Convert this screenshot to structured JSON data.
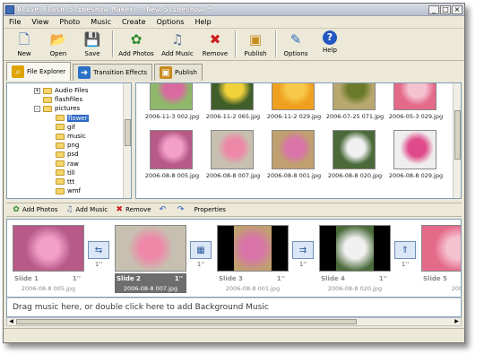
{
  "window": {
    "title": "Alive Flash Slideshow Maker - New Slideshow *",
    "controls": [
      "_",
      "□",
      "×"
    ]
  },
  "menu": [
    "File",
    "View",
    "Photo",
    "Music",
    "Create",
    "Options",
    "Help"
  ],
  "toolbar": [
    {
      "label": "New",
      "icon": "new-file-icon",
      "glyph": "🗋",
      "color": "#2e5fb0"
    },
    {
      "label": "Open",
      "icon": "folder-open-icon",
      "glyph": "📂",
      "color": "#d9a521"
    },
    {
      "label": "Save",
      "icon": "floppy-save-icon",
      "glyph": "💾",
      "color": "#3d55b8"
    },
    {
      "label": "Add Photos",
      "icon": "add-photos-icon",
      "glyph": "✿",
      "color": "#2d8a2d"
    },
    {
      "label": "Add Music",
      "icon": "add-music-icon",
      "glyph": "♫",
      "color": "#5c6f9c"
    },
    {
      "label": "Remove",
      "icon": "remove-x-icon",
      "glyph": "✖",
      "color": "#cc1f1f"
    },
    {
      "label": "Publish",
      "icon": "publish-icon",
      "glyph": "▣",
      "color": "#c88a1c"
    },
    {
      "label": "Options",
      "icon": "options-icon",
      "glyph": "✎",
      "color": "#2c6cc0"
    },
    {
      "label": "Help",
      "icon": "help-icon",
      "glyph": "?",
      "color": "#2456c2"
    }
  ],
  "tabs": [
    {
      "label": "File Explorer",
      "icon": "file-explorer-icon",
      "color": "#e0a400"
    },
    {
      "label": "Transition Effects",
      "icon": "transition-effects-icon",
      "color": "#2b71c9"
    },
    {
      "label": "Publish",
      "icon": "publish-tab-icon",
      "color": "#c88a1c"
    }
  ],
  "tree": [
    {
      "label": "Audio Files",
      "expander": "+"
    },
    {
      "label": "flashfiles",
      "expander": ""
    },
    {
      "label": "pictures",
      "expander": "-"
    },
    {
      "label": "flower",
      "expander": "",
      "selected": true
    },
    {
      "label": "gif",
      "expander": ""
    },
    {
      "label": "music",
      "expander": ""
    },
    {
      "label": "png",
      "expander": ""
    },
    {
      "label": "psd",
      "expander": ""
    },
    {
      "label": "raw",
      "expander": ""
    },
    {
      "label": "till",
      "expander": ""
    },
    {
      "label": "ttt",
      "expander": ""
    },
    {
      "label": "wmf",
      "expander": ""
    }
  ],
  "thumbnails": [
    {
      "caption": "2006-11-3 002.jpg",
      "bg": "#8fb86a",
      "fg": "#d96aa0"
    },
    {
      "caption": "2006-11-2 065.jpg",
      "bg": "#3f5e2a",
      "fg": "#f2d13a"
    },
    {
      "caption": "2006-11-2 029.jpg",
      "bg": "#f0a020",
      "fg": "#f7c94a"
    },
    {
      "caption": "2006-07-25 071.jpg",
      "bg": "#b8a870",
      "fg": "#6b7a2a"
    },
    {
      "caption": "2006-05-3 029.jpg",
      "bg": "#e46a8a",
      "fg": "#f5c2d2"
    },
    {
      "caption": "2006-08-8 005.jpg",
      "bg": "#b85a88",
      "fg": "#f2a0c8"
    },
    {
      "caption": "2006-08-8 007.jpg",
      "bg": "#c7c0b0",
      "fg": "#ee88a8"
    },
    {
      "caption": "2006-08-8 001.jpg",
      "bg": "#c0a070",
      "fg": "#d874a8"
    },
    {
      "caption": "2006-08-8 020.jpg",
      "bg": "#4a6a3a",
      "fg": "#f0f0f0"
    },
    {
      "caption": "2006-08-8 029.jpg",
      "bg": "#eeeeee",
      "fg": "#e04a8a"
    }
  ],
  "storyboard_toolbar": [
    {
      "label": "Add Photos",
      "icon": "add-photos-small-icon",
      "glyph": "✿",
      "color": "#2d8a2d"
    },
    {
      "label": "Add Music",
      "icon": "add-music-small-icon",
      "glyph": "♫",
      "color": "#5c6f9c"
    },
    {
      "label": "Remove",
      "icon": "remove-small-icon",
      "glyph": "✖",
      "color": "#cc1f1f"
    },
    {
      "label": "",
      "icon": "rotate-left-icon",
      "glyph": "↶",
      "color": "#2456c2"
    },
    {
      "label": "",
      "icon": "rotate-right-icon",
      "glyph": "↷",
      "color": "#2456c2"
    },
    {
      "label": "Properties",
      "icon": "",
      "glyph": "",
      "color": "#000000"
    }
  ],
  "slides": [
    {
      "name": "Slide 1",
      "duration": "1''",
      "file": "2006-08-8 005.jpg",
      "bg": "#b85a88",
      "fg": "#f2a0c8",
      "selected": false
    },
    {
      "name": "Slide 2",
      "duration": "1''",
      "file": "2006-08-8 007.jpg",
      "bg": "#c7c0b0",
      "fg": "#ee88a8",
      "selected": true
    },
    {
      "name": "Slide 3",
      "duration": "1''",
      "file": "2006-08-8 001.jpg",
      "bg": "#c0a070",
      "fg": "#d874a8",
      "selected": false
    },
    {
      "name": "Slide 4",
      "duration": "1''",
      "file": "2006-08-8 020.jpg",
      "bg": "#4a6a3a",
      "fg": "#f0f0f0",
      "selected": false
    },
    {
      "name": "Slide 5",
      "duration": "",
      "file": "200",
      "bg": "#e46a8a",
      "fg": "#f5c2d2",
      "selected": false
    }
  ],
  "transitions": [
    {
      "duration": "1''",
      "icon": "transition-icon",
      "glyph": "⇆"
    },
    {
      "duration": "1''",
      "icon": "transition-icon",
      "glyph": "▦"
    },
    {
      "duration": "1''",
      "icon": "transition-icon",
      "glyph": "⇉"
    },
    {
      "duration": "1''",
      "icon": "transition-icon",
      "glyph": "⇑"
    }
  ],
  "music_hint": "Drag music here, or double click here to add Background Music"
}
